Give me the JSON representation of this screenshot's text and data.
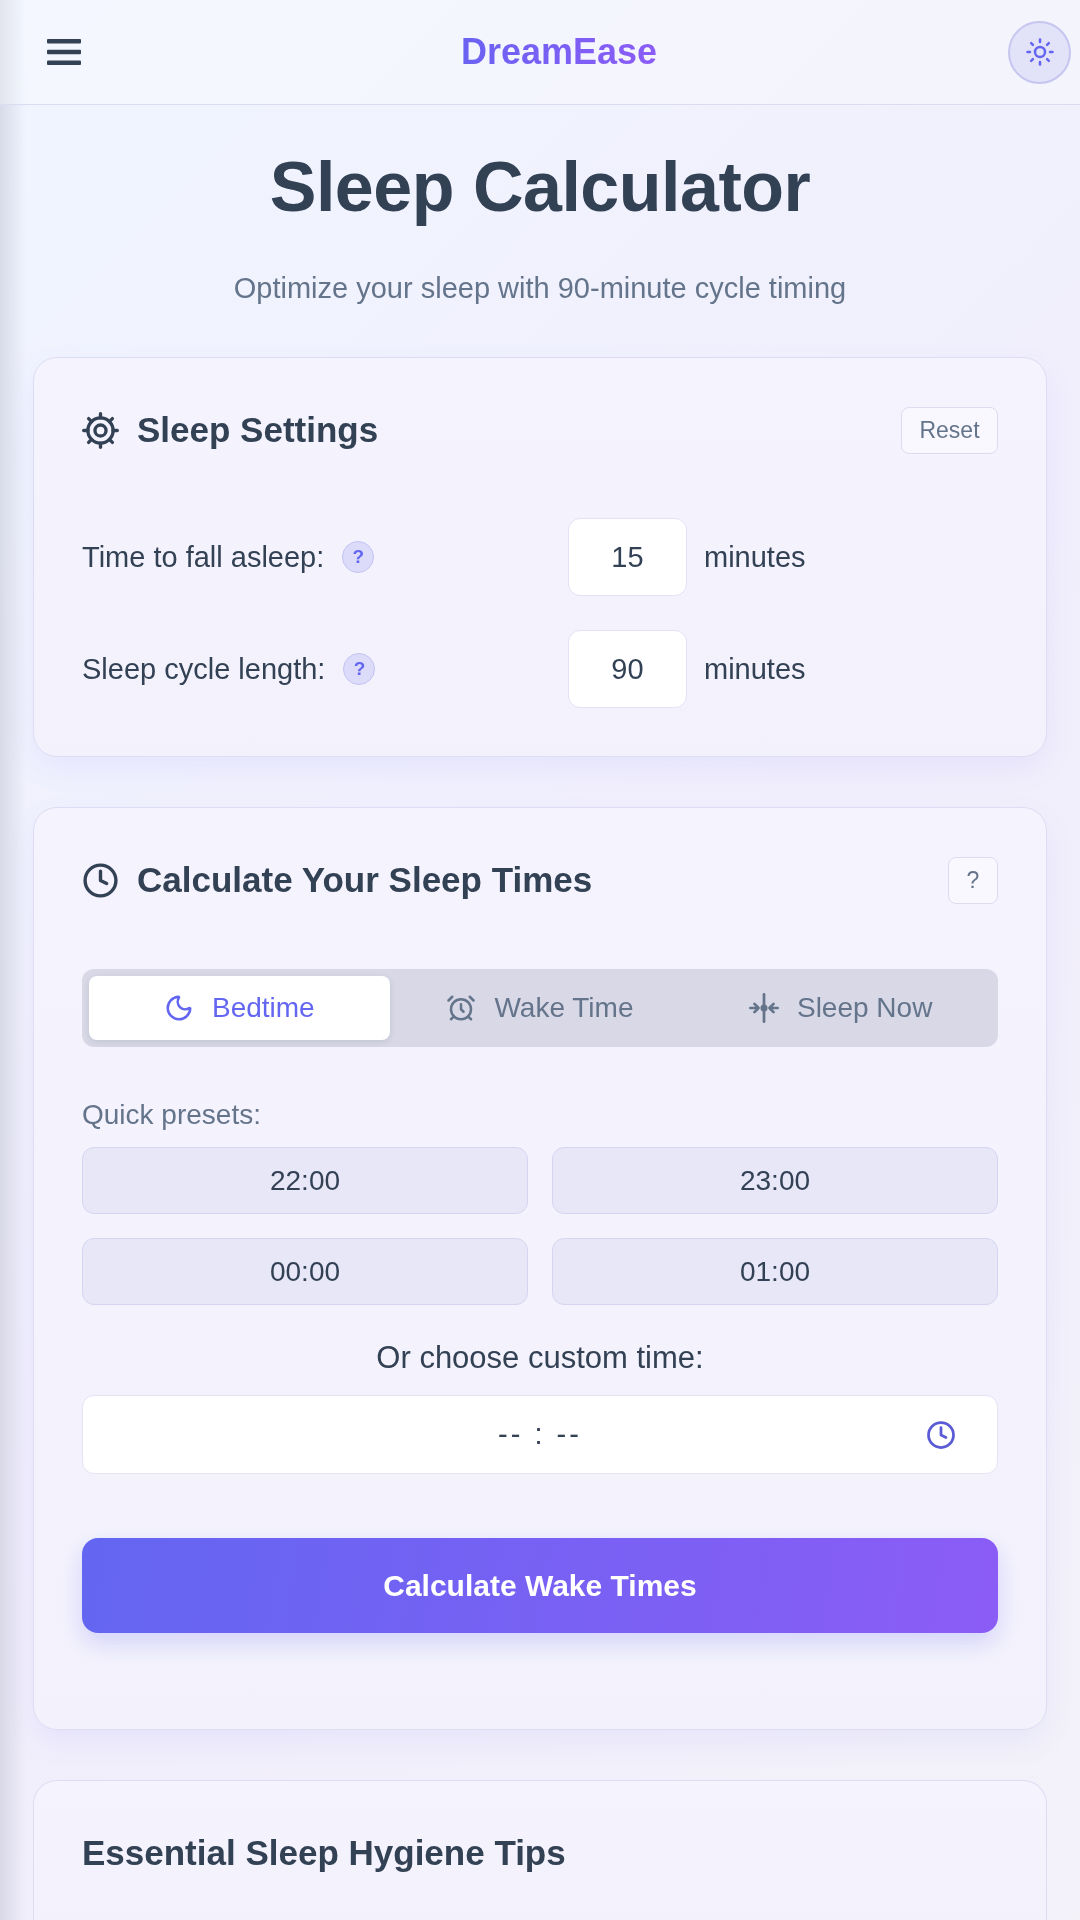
{
  "header": {
    "brand": "DreamEase"
  },
  "hero": {
    "title": "Sleep Calculator",
    "subtitle": "Optimize your sleep with 90-minute cycle timing"
  },
  "settings": {
    "title": "Sleep Settings",
    "reset_label": "Reset",
    "fields": [
      {
        "label": "Time to fall asleep:",
        "help": "?",
        "value": "15",
        "unit": "minutes"
      },
      {
        "label": "Sleep cycle length:",
        "help": "?",
        "value": "90",
        "unit": "minutes"
      }
    ]
  },
  "calculator": {
    "title": "Calculate Your Sleep Times",
    "help": "?",
    "modes": [
      {
        "label": "Bedtime",
        "selected": true
      },
      {
        "label": "Wake Time",
        "selected": false
      },
      {
        "label": "Sleep Now",
        "selected": false
      }
    ],
    "presets_label": "Quick presets:",
    "presets": [
      "22:00",
      "23:00",
      "00:00",
      "01:00"
    ],
    "custom_label": "Or choose custom time:",
    "time_field": {
      "placeholder": "-- : --"
    },
    "submit": "Calculate Wake Times"
  },
  "tips": {
    "title": "Essential Sleep Hygiene Tips"
  }
}
